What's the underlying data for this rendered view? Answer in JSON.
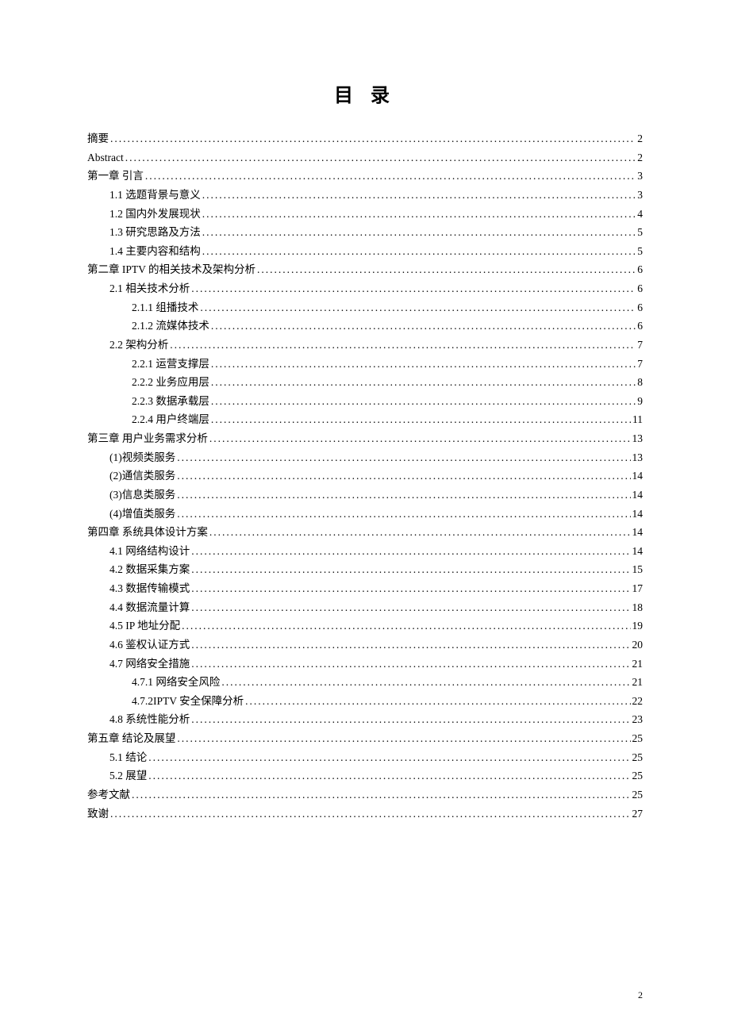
{
  "title": "目 录",
  "page_number": "2",
  "toc": [
    {
      "level": 0,
      "label": "摘要",
      "page": "2"
    },
    {
      "level": 0,
      "label": "Abstract",
      "page": "2"
    },
    {
      "level": 0,
      "label": "第一章  引言",
      "page": "3"
    },
    {
      "level": 1,
      "label": "1.1  选题背景与意义",
      "page": "3"
    },
    {
      "level": 1,
      "label": "1.2  国内外发展现状",
      "page": "4"
    },
    {
      "level": 1,
      "label": "1.3  研究思路及方法",
      "page": "5"
    },
    {
      "level": 1,
      "label": "1.4  主要内容和结构",
      "page": "5"
    },
    {
      "level": 0,
      "label": "第二章  IPTV 的相关技术及架构分析",
      "page": "6"
    },
    {
      "level": 1,
      "label": "2.1  相关技术分析",
      "page": "6"
    },
    {
      "level": 2,
      "label": "2.1.1 组播技术",
      "page": "6"
    },
    {
      "level": 2,
      "label": "2.1.2 流媒体技术",
      "page": "6"
    },
    {
      "level": 1,
      "label": "2.2  架构分析",
      "page": "7"
    },
    {
      "level": 2,
      "label": "2.2.1 运营支撑层",
      "page": "7"
    },
    {
      "level": 2,
      "label": "2.2.2 业务应用层",
      "page": "8"
    },
    {
      "level": 2,
      "label": "2.2.3 数据承载层",
      "page": "9"
    },
    {
      "level": 2,
      "label": "2.2.4 用户终端层",
      "page": "11"
    },
    {
      "level": 0,
      "label": "第三章  用户业务需求分析",
      "page": "13"
    },
    {
      "level": 1,
      "label": "(1)视频类服务",
      "page": "13"
    },
    {
      "level": 1,
      "label": "(2)通信类服务",
      "page": "14"
    },
    {
      "level": 1,
      "label": "(3)信息类服务",
      "page": "14"
    },
    {
      "level": 1,
      "label": "(4)增值类服务",
      "page": "14"
    },
    {
      "level": 0,
      "label": "第四章  系统具体设计方案",
      "page": "14"
    },
    {
      "level": 1,
      "label": "4.1  网络结构设计",
      "page": "14"
    },
    {
      "level": 1,
      "label": "4.2  数据采集方案",
      "page": "15"
    },
    {
      "level": 1,
      "label": "4.3  数据传输模式",
      "page": "17"
    },
    {
      "level": 1,
      "label": "4.4  数据流量计算",
      "page": "18"
    },
    {
      "level": 1,
      "label": "4.5 IP 地址分配",
      "page": "19"
    },
    {
      "level": 1,
      "label": "4.6 鉴权认证方式",
      "page": "20"
    },
    {
      "level": 1,
      "label": "4.7 网络安全措施",
      "page": "21"
    },
    {
      "level": 2,
      "label": "4.7.1 网络安全风险",
      "page": "21"
    },
    {
      "level": 2,
      "label": "4.7.2IPTV 安全保障分析",
      "page": "22"
    },
    {
      "level": 1,
      "label": "4.8 系统性能分析",
      "page": "23"
    },
    {
      "level": 0,
      "label": "第五章  结论及展望",
      "page": "25"
    },
    {
      "level": 1,
      "label": "5.1 结论",
      "page": "25"
    },
    {
      "level": 1,
      "label": "5.2 展望",
      "page": "25"
    },
    {
      "level": 0,
      "label": "参考文献",
      "page": "25"
    },
    {
      "level": 0,
      "label": "致谢",
      "page": "27"
    }
  ]
}
